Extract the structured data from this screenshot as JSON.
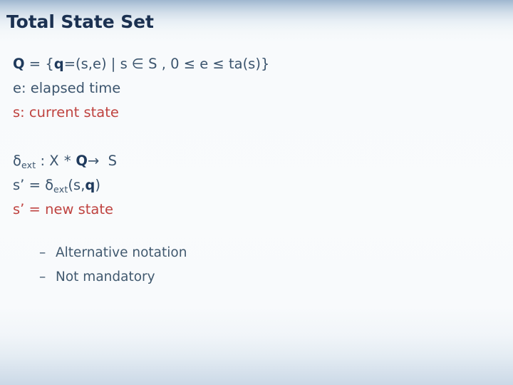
{
  "slide": {
    "title": "Total State Set",
    "background_top_color": "#9fb7cf",
    "background_mid_color": "#f8fafc",
    "background_bottom_color": "#cbd9e7",
    "title_color": "#1b3151",
    "body_color": "#3c556e",
    "accent_color": "#bf4340",
    "bold_color": "#1f3a5c"
  },
  "body": {
    "lines": [
      {
        "id": "total-state-set-definition",
        "parts": [
          {
            "text": "Q",
            "bold": true
          },
          {
            "text": " = {",
            "bold": false
          },
          {
            "text": "q",
            "bold": true
          },
          {
            "text": "=(s,e) | s ∈ S , 0 ≤ e ≤ ta(s)}",
            "bold": false
          }
        ],
        "plain": "Q = {q=(s,e) | s ∈ S , 0 ≤ e ≤ ta(s)}",
        "color": "body"
      },
      {
        "id": "elapsed-time-definition",
        "plain": "e: elapsed time",
        "color": "body"
      },
      {
        "id": "current-state-definition",
        "plain": "s: current state",
        "color": "accent"
      },
      {
        "id": "external-transition-signature",
        "plain": "δext : X * Q →  S",
        "color": "body"
      },
      {
        "id": "external-transition-application",
        "plain": "s’ = δext(s,q)",
        "color": "body"
      },
      {
        "id": "new-state-definition",
        "plain": "s’ = new state",
        "color": "accent"
      }
    ],
    "symbols": {
      "delta": "δ",
      "subscript_ext": "ext",
      "colon": ":",
      "cross_product": "X *",
      "arrow": "→",
      "state_set": "S",
      "total_state_set": "Q",
      "total_state": "q",
      "prime_s": "s’",
      "equals": "=",
      "open_paren_s_q": "(s,",
      "close_paren": ")"
    }
  },
  "bullets": {
    "dash": "–",
    "items": [
      {
        "id": "alternative-notation",
        "label": "Alternative notation"
      },
      {
        "id": "not-mandatory",
        "label": "Not mandatory"
      }
    ]
  }
}
